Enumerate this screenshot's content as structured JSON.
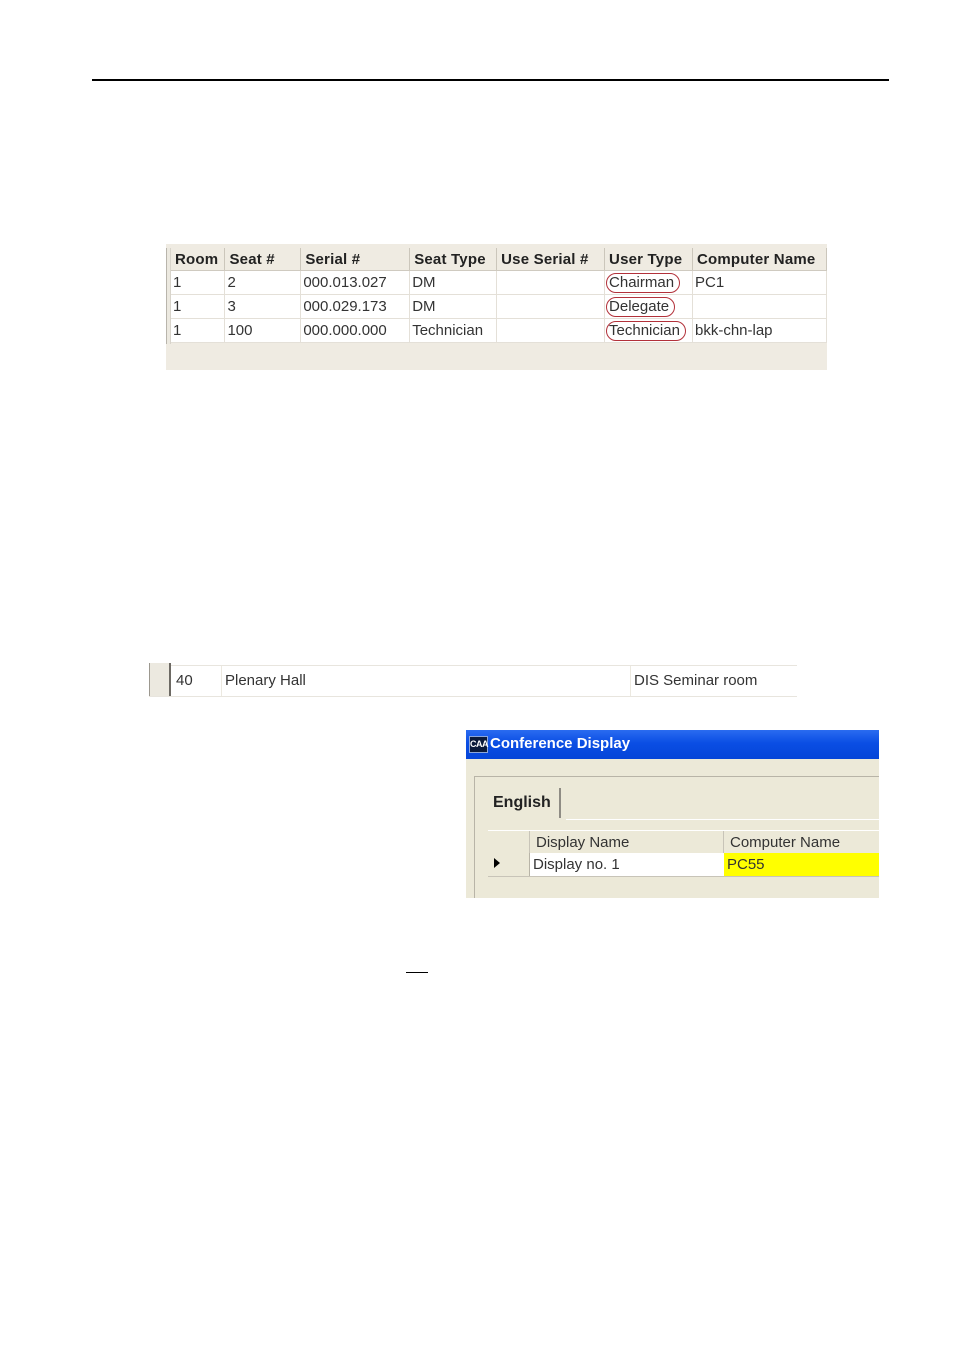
{
  "seat_grid": {
    "columns": [
      "Room",
      "Seat #",
      "Serial #",
      "Seat Type",
      "Use Serial #",
      "User Type",
      "Computer Name"
    ],
    "rows": [
      {
        "room": "1",
        "seat": "2",
        "serial": "000.013.027",
        "seat_type": "DM",
        "use_serial": "",
        "user_type": "Chairman",
        "computer_name": "PC1"
      },
      {
        "room": "1",
        "seat": "3",
        "serial": "000.029.173",
        "seat_type": "DM",
        "use_serial": "",
        "user_type": "Delegate",
        "computer_name": ""
      },
      {
        "room": "1",
        "seat": "100",
        "serial": "000.000.000",
        "seat_type": "Technician",
        "use_serial": "",
        "user_type": "Technician",
        "computer_name": "bkk-chn-lap"
      }
    ],
    "highlight_color": "#b2313a"
  },
  "room_row": {
    "number": "40",
    "name": "Plenary Hall",
    "description": "DIS Seminar room"
  },
  "conference_display": {
    "window_title": "Conference Display",
    "app_icon_label": "CAA",
    "tab_label": "English",
    "columns": [
      "Display Name",
      "Computer Name"
    ],
    "rows": [
      {
        "display_name": "Display no. 1",
        "computer_name": "PC55"
      }
    ],
    "selected_cell_color": "#ffff00",
    "titlebar_color": "#0a4ee4"
  }
}
